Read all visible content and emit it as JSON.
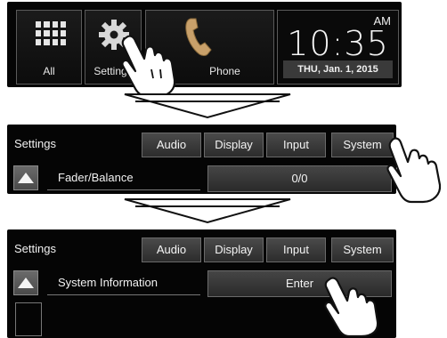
{
  "home": {
    "tiles": [
      {
        "label": "All",
        "icon": "grid-icon"
      },
      {
        "label": "Settings",
        "icon": "gear-icon"
      },
      {
        "label": "Phone",
        "icon": "phone-icon"
      }
    ],
    "clock": {
      "ampm": "AM",
      "time": "10:35",
      "date": "THU, Jan. 1, 2015"
    }
  },
  "settings_fader": {
    "title": "Settings",
    "tabs": [
      "Audio",
      "Display",
      "Input",
      "System"
    ],
    "row_label": "Fader/Balance",
    "row_value": "0/0"
  },
  "settings_system": {
    "title": "Settings",
    "tabs": [
      "Audio",
      "Display",
      "Input",
      "System"
    ],
    "row_label": "System Information",
    "row_value": "Enter"
  },
  "colors": {
    "phone_accent": "#c8a06a",
    "panel_bg": "#050505"
  }
}
